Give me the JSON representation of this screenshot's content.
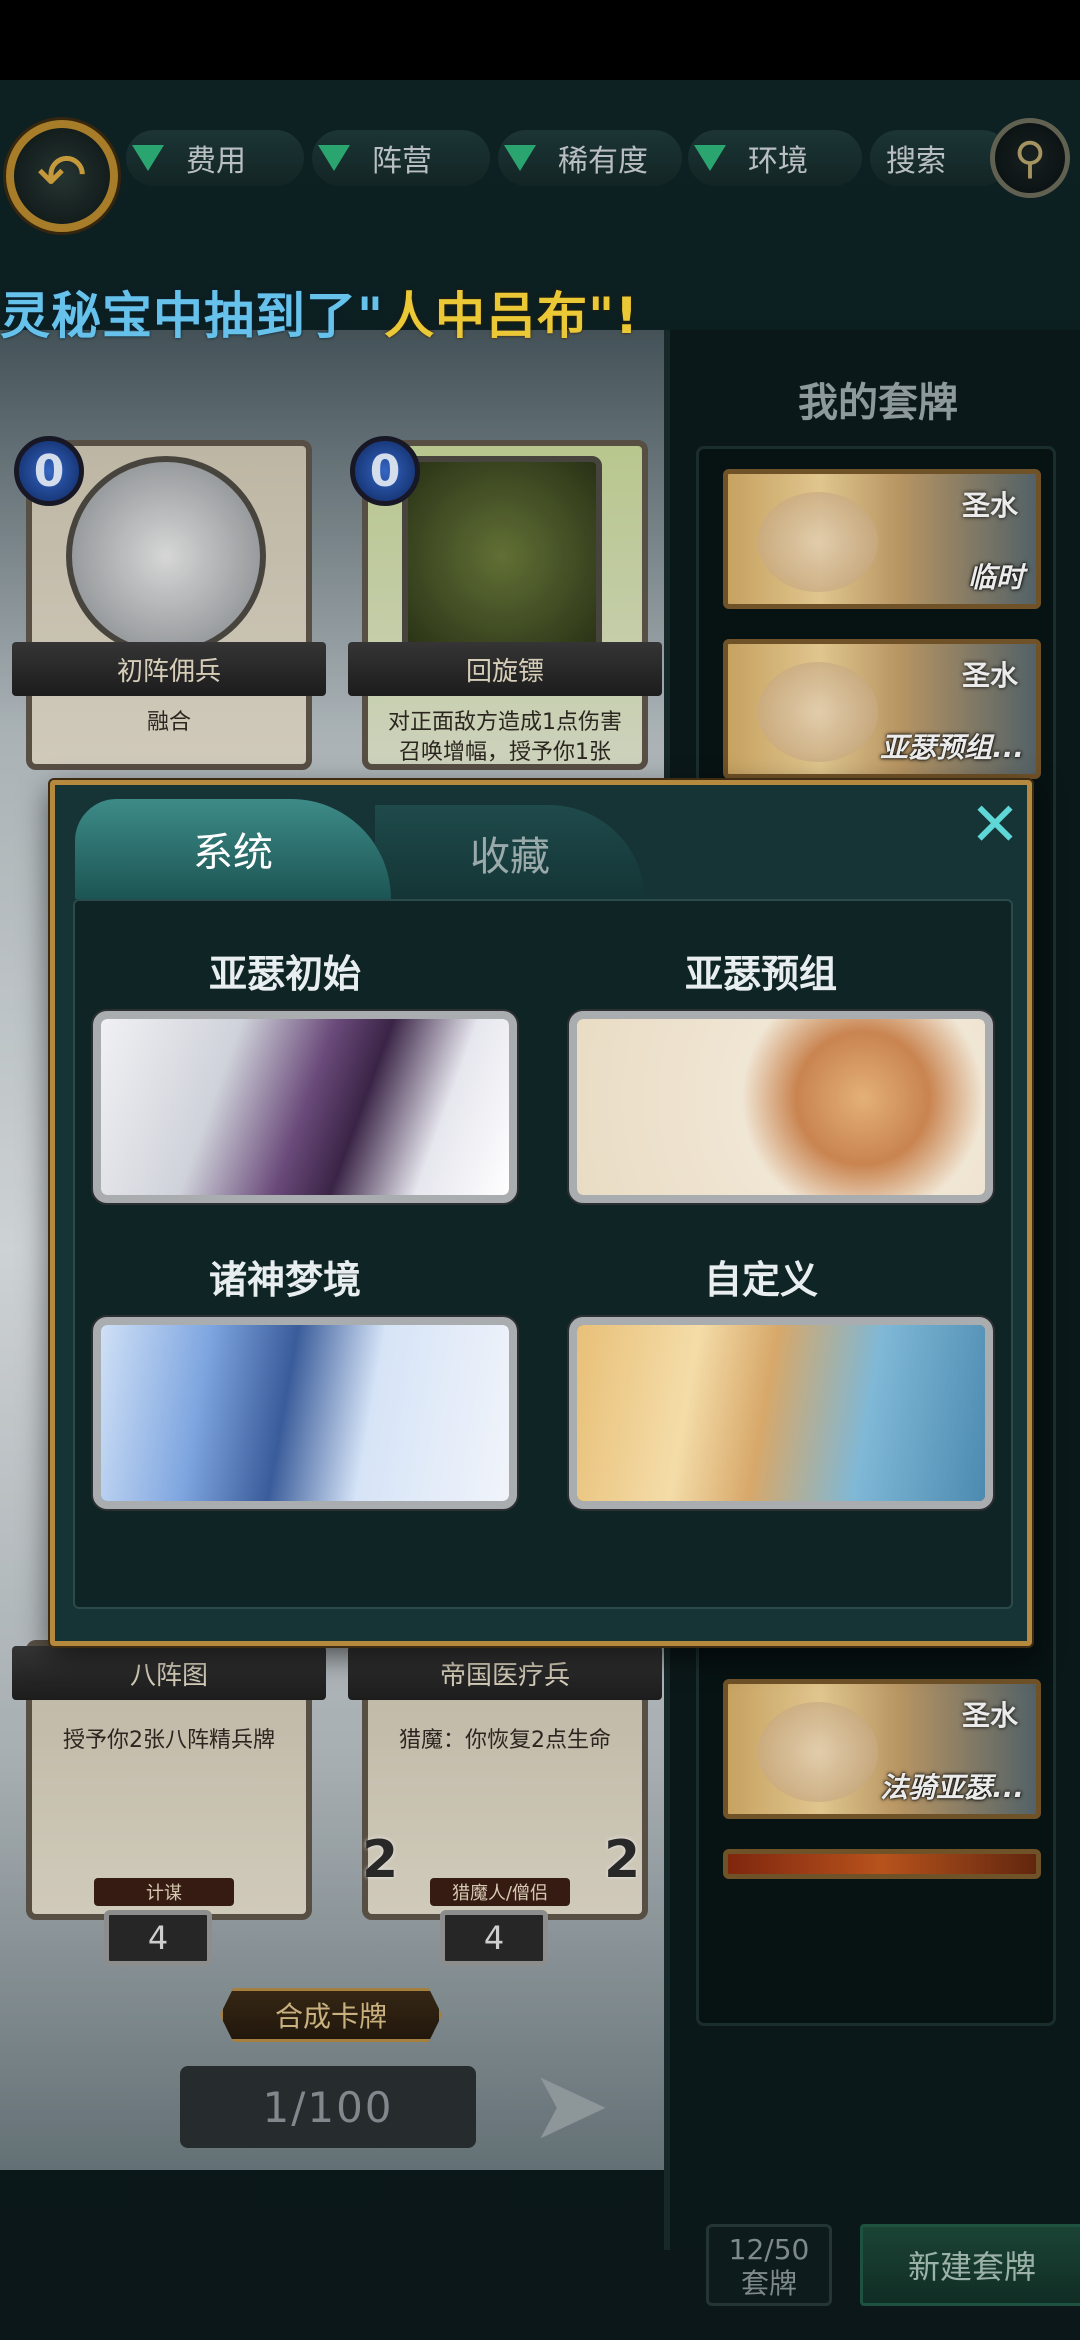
{
  "filters": [
    "费用",
    "阵营",
    "稀有度",
    "环境"
  ],
  "search_label": "搜索",
  "marquee": {
    "part1": "灵秘宝中抽到了\"",
    "part2": "人中吕布",
    "part3": "\"!"
  },
  "cards": [
    {
      "name": "初阵佣兵",
      "cost": "0",
      "desc": "融合"
    },
    {
      "name": "回旋镖",
      "cost": "0",
      "desc": "对正面敌方造成1点伤害 召唤增幅，授予你1张"
    },
    {
      "name": "八阵图",
      "desc": "授予你2张八阵精兵牌",
      "tag": "计谋",
      "count": "4"
    },
    {
      "name": "帝国医疗兵",
      "desc": "猎魔：你恢复2点生命",
      "tag": "猎魔人/僧侣",
      "count": "4",
      "side_left": "2",
      "side_right": "2"
    }
  ],
  "synth_label": "合成卡牌",
  "pager": "1/100",
  "deck": {
    "title": "我的套牌",
    "items": [
      {
        "faction": "圣水",
        "name": "临时"
      },
      {
        "faction": "圣水",
        "name": "亚瑟预组..."
      },
      {
        "faction": "圣水",
        "name": "法骑亚瑟..."
      }
    ],
    "count_top": "12/50",
    "count_bottom": "套牌",
    "new_label": "新建套牌"
  },
  "dialog": {
    "tab_system": "系统",
    "tab_favs": "收藏",
    "options": [
      "亚瑟初始",
      "亚瑟预组",
      "诸神梦境",
      "自定义"
    ]
  },
  "colors": {
    "accent_gold": "#b58a3e",
    "teal": "#3d8b88",
    "marquee_blue": "#6fd2ff",
    "marquee_yellow": "#ffd93a"
  }
}
